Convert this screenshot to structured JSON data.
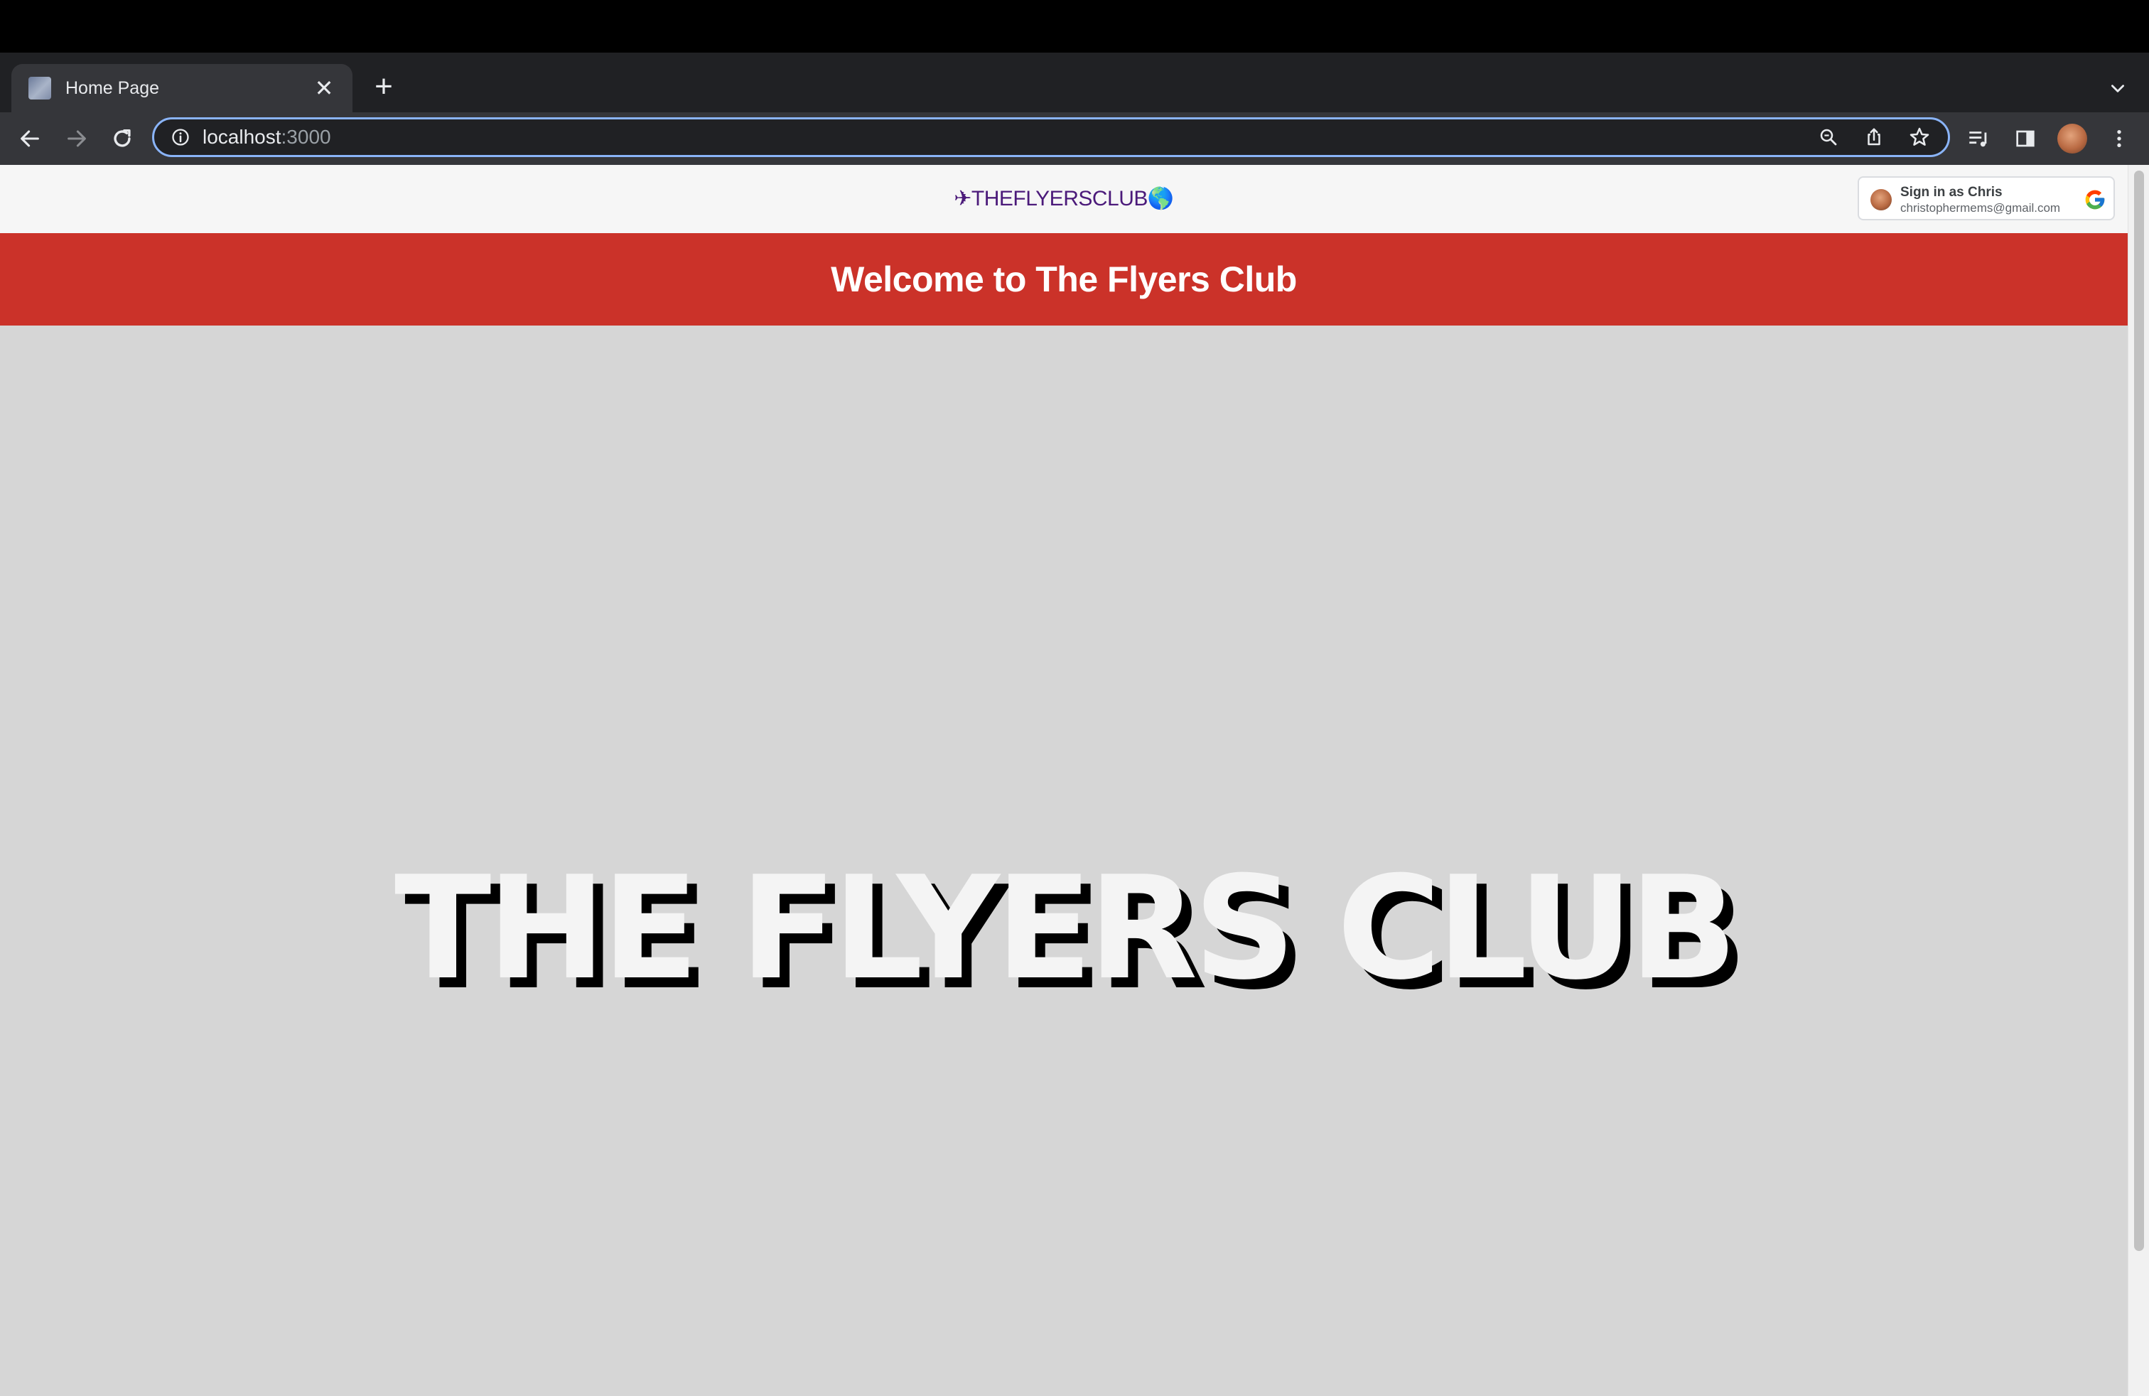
{
  "browser": {
    "tab": {
      "title": "Home Page",
      "close_glyph": "✕"
    },
    "new_tab_glyph": "+",
    "address": {
      "host": "localhost",
      "port": ":3000"
    }
  },
  "site": {
    "logo_text": "✈THEFLYERSCLUB🌎",
    "signin": {
      "name_label": "Sign in as Chris",
      "email": "christophermems@gmail.com"
    },
    "banner_title": "Welcome to The Flyers Club",
    "hero_title": "THE FLYERS CLUB"
  },
  "colors": {
    "banner": "#cb3229",
    "logo": "#4b1a7a",
    "page_bg": "#d6d6d6",
    "header_bg": "#f6f6f6",
    "omnibox_focus": "#8ab4f8"
  },
  "icons": {
    "tab_favicon": "favicon-icon",
    "tab_close": "close-icon",
    "new_tab": "plus-icon",
    "tab_search": "chevron-down-icon",
    "back": "back-arrow-icon",
    "forward": "forward-arrow-icon",
    "reload": "reload-icon",
    "site_info": "info-icon",
    "zoom": "zoom-icon",
    "share": "share-icon",
    "bookmark": "star-icon",
    "reading_list": "media-controls-icon",
    "side_panel": "side-panel-icon",
    "profile": "profile-avatar",
    "menu": "kebab-menu-icon",
    "google": "google-g-icon"
  }
}
